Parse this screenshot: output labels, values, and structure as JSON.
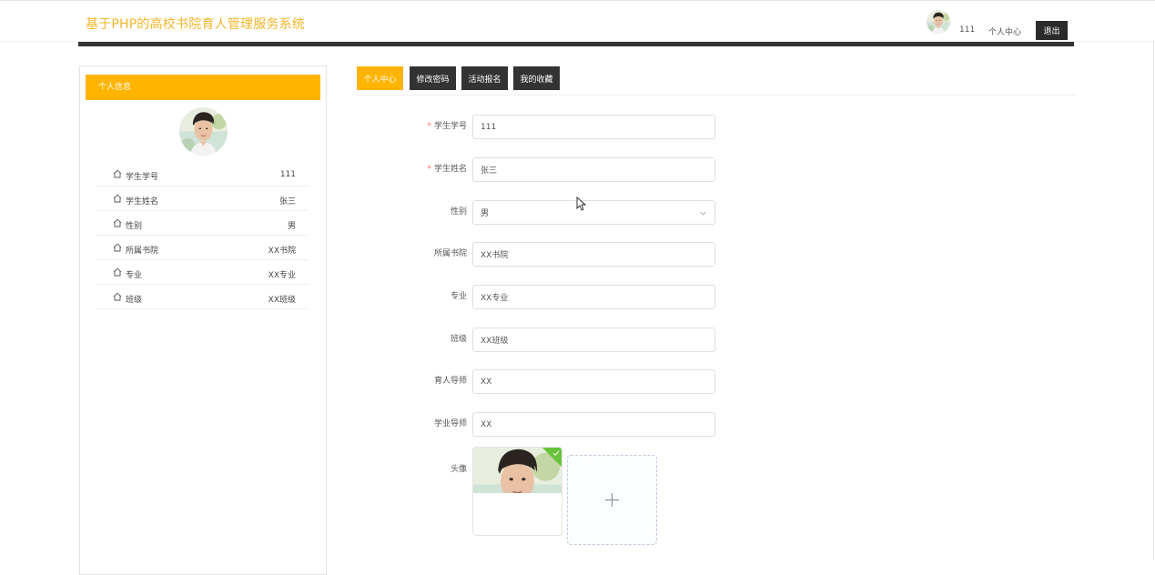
{
  "header": {
    "site_title": "基于PHP的高校书院育人管理服务系统",
    "user_id": "111",
    "user_center": "个人中心",
    "logout": "退出"
  },
  "sidebar": {
    "title": "个人信息",
    "items": [
      {
        "label": "学生学号",
        "value": "111"
      },
      {
        "label": "学生姓名",
        "value": "张三"
      },
      {
        "label": "性别",
        "value": "男"
      },
      {
        "label": "所属书院",
        "value": "XX书院"
      },
      {
        "label": "专业",
        "value": "XX专业"
      },
      {
        "label": "班级",
        "value": "XX班级"
      }
    ]
  },
  "tabs": [
    {
      "label": "个人中心",
      "active": true
    },
    {
      "label": "修改密码",
      "active": false
    },
    {
      "label": "活动报名",
      "active": false
    },
    {
      "label": "我的收藏",
      "active": false
    }
  ],
  "form": {
    "student_id": {
      "label": "学生学号",
      "value": "111",
      "required": true
    },
    "student_name": {
      "label": "学生姓名",
      "value": "张三",
      "required": true
    },
    "gender": {
      "label": "性别",
      "value": "男"
    },
    "academy": {
      "label": "所属书院",
      "value": "XX书院"
    },
    "major": {
      "label": "专业",
      "value": "XX专业"
    },
    "class": {
      "label": "班级",
      "value": "XX班级"
    },
    "mentor": {
      "label": "育人导师",
      "value": "XX"
    },
    "academic_tutor": {
      "label": "学业导师",
      "value": "XX"
    },
    "avatar": {
      "label": "头像"
    }
  },
  "colors": {
    "accent": "#ffb400",
    "title": "#f0b62a",
    "dark": "#333333",
    "required": "#f56c6c",
    "success": "#67c23a"
  },
  "icons": [
    "home-icon",
    "chevron-down-icon",
    "plus-icon",
    "check-icon",
    "cursor-icon"
  ]
}
